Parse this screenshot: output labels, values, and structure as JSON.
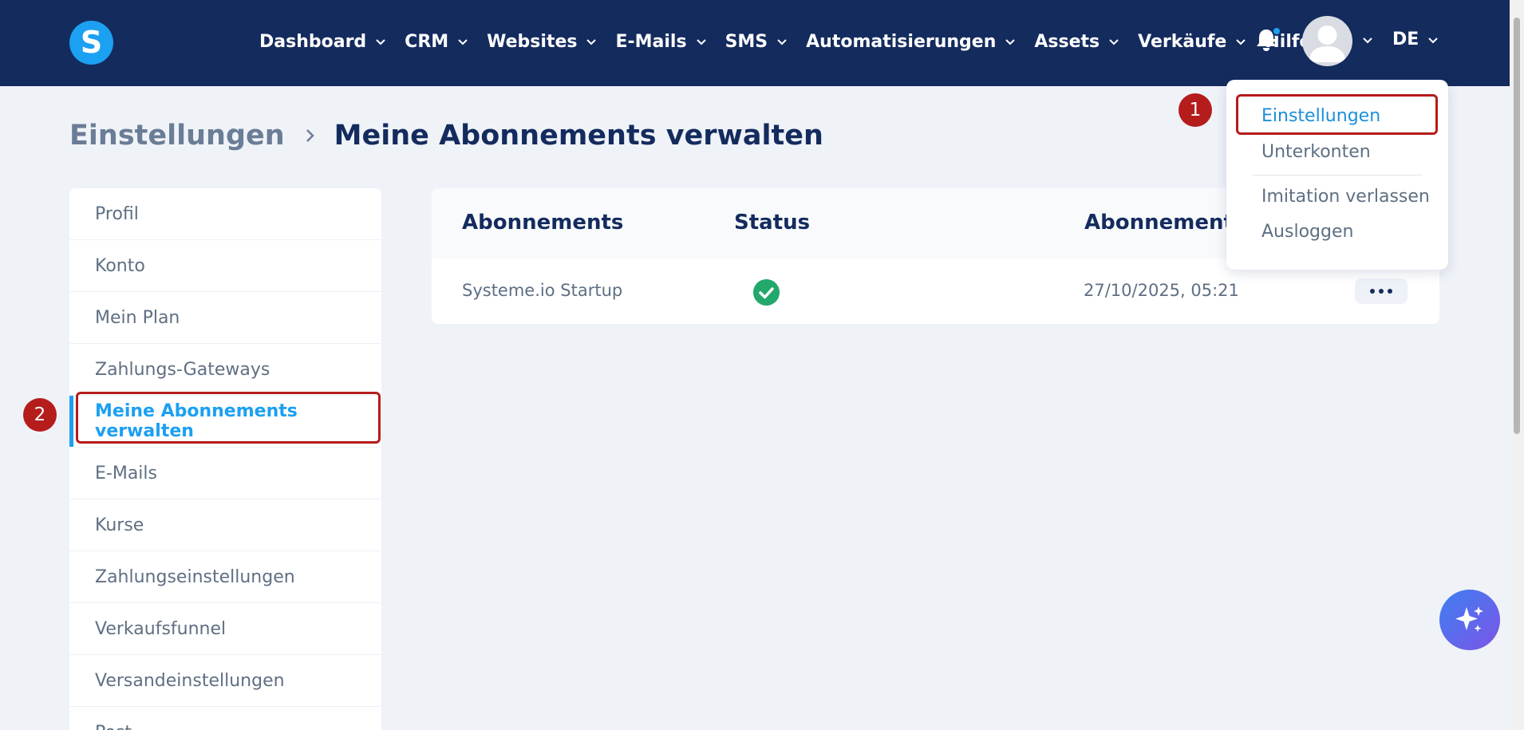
{
  "app": {
    "logo_letter": "S"
  },
  "nav": {
    "items": [
      {
        "label": "Dashboard",
        "has_chevron": true
      },
      {
        "label": "CRM",
        "has_chevron": true
      },
      {
        "label": "Websites",
        "has_chevron": true
      },
      {
        "label": "E-Mails",
        "has_chevron": true
      },
      {
        "label": "SMS",
        "has_chevron": true
      },
      {
        "label": "Automatisierungen",
        "has_chevron": true
      },
      {
        "label": "Assets",
        "has_chevron": true
      },
      {
        "label": "Verkäufe",
        "has_chevron": true
      },
      {
        "label": "Hilfe",
        "has_chevron": false
      }
    ],
    "language": "DE"
  },
  "breadcrumb": {
    "parent": "Einstellungen",
    "current": "Meine Abonnements verwalten"
  },
  "sidebar": {
    "items": [
      {
        "label": "Profil"
      },
      {
        "label": "Konto"
      },
      {
        "label": "Mein Plan"
      },
      {
        "label": "Zahlungs-Gateways"
      },
      {
        "label": "Meine Abonnements verwalten",
        "active": true
      },
      {
        "label": "E-Mails"
      },
      {
        "label": "Kurse"
      },
      {
        "label": "Zahlungseinstellungen"
      },
      {
        "label": "Verkaufsfunnel"
      },
      {
        "label": "Versandeinstellungen"
      },
      {
        "label": "Post"
      }
    ]
  },
  "subscriptions": {
    "columns": [
      "Abonnements",
      "Status",
      "Abonnemento"
    ],
    "rows": [
      {
        "name": "Systeme.io Startup",
        "status": "active",
        "date": "27/10/2025, 05:21"
      }
    ]
  },
  "user_menu": {
    "items": [
      "Einstellungen",
      "Unterkonten",
      "Imitation verlassen",
      "Ausloggen"
    ]
  },
  "annotations": {
    "marker_1": "1",
    "marker_2": "2"
  },
  "colors": {
    "topbar": "#142b5e",
    "accent": "#1ca0f2",
    "success": "#22a86b",
    "annotation": "#b51c1c"
  }
}
